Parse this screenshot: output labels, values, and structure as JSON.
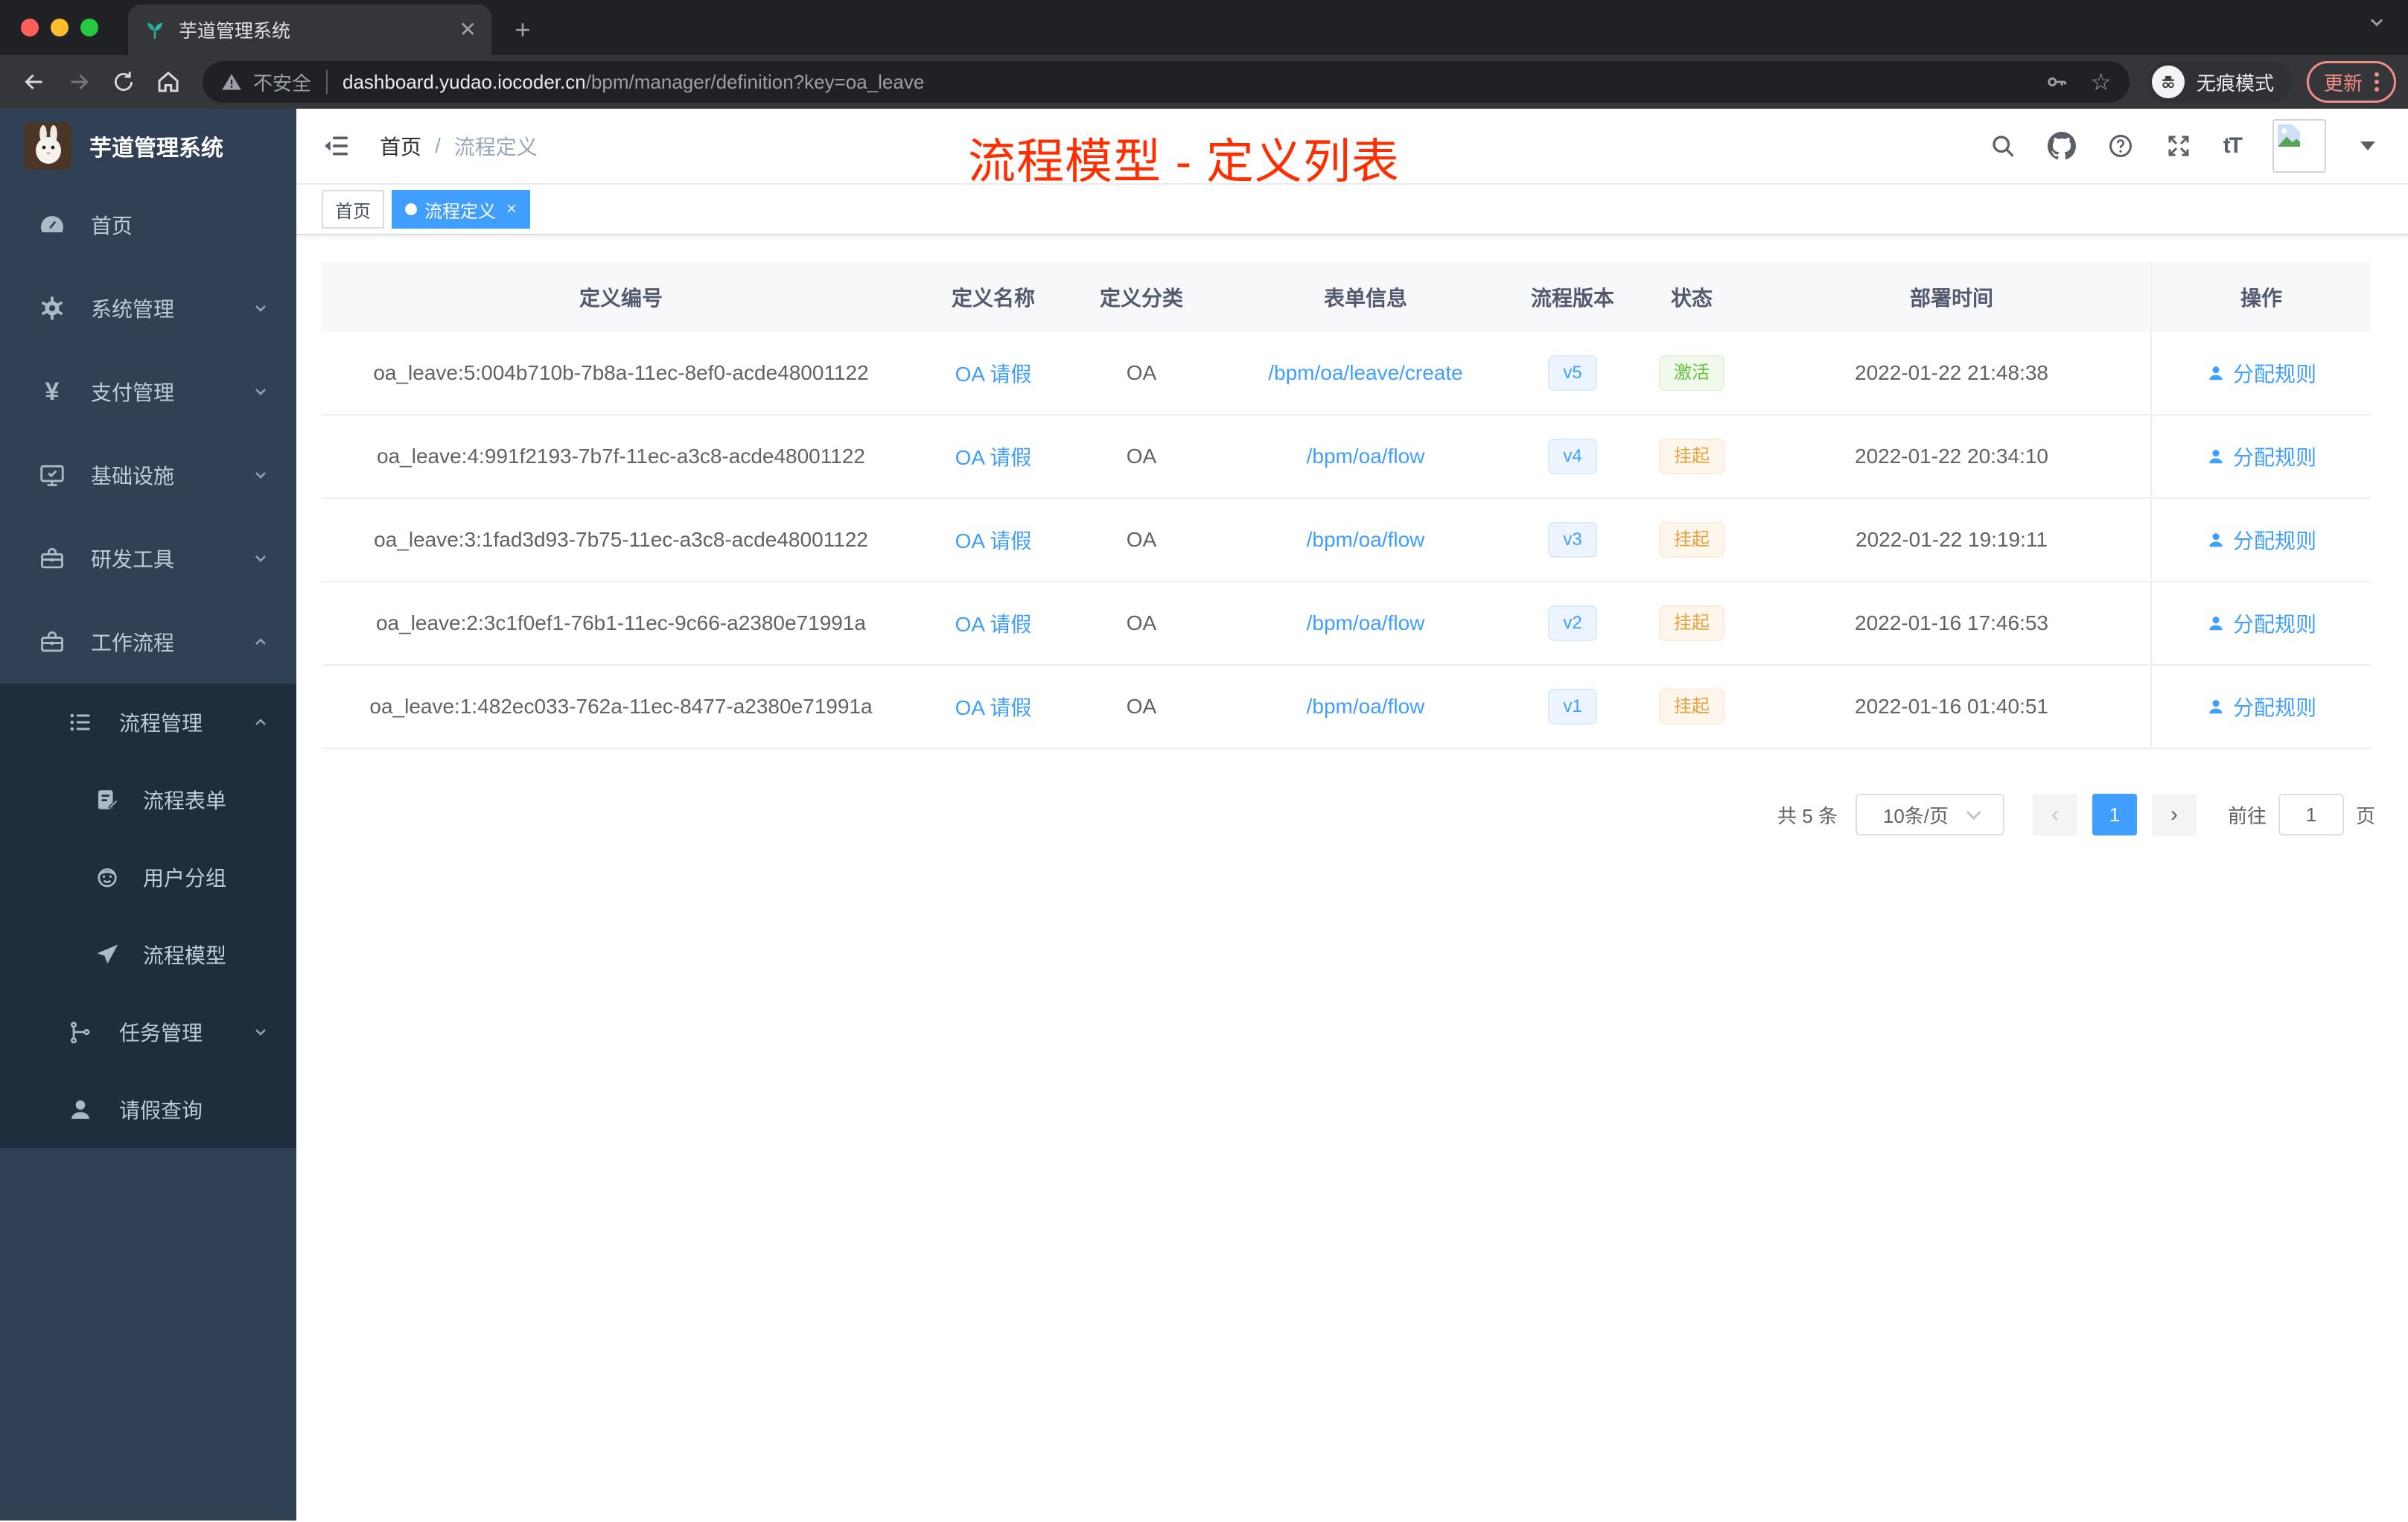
{
  "browser": {
    "tab_title": "芋道管理系统",
    "security_label": "不安全",
    "url_host": "dashboard.yudao.iocoder.cn",
    "url_path": "/bpm/manager/definition?key=oa_leave",
    "incognito_label": "无痕模式",
    "update_label": "更新"
  },
  "sidebar": {
    "logo_title": "芋道管理系统",
    "items": [
      {
        "label": "首页",
        "icon": "dashboard-icon",
        "level": 1
      },
      {
        "label": "系统管理",
        "icon": "gear-icon",
        "level": 1,
        "chevron": "down"
      },
      {
        "label": "支付管理",
        "icon": "yen-icon",
        "level": 1,
        "chevron": "down"
      },
      {
        "label": "基础设施",
        "icon": "monitor-icon",
        "level": 1,
        "chevron": "down"
      },
      {
        "label": "研发工具",
        "icon": "toolbox-icon",
        "level": 1,
        "chevron": "down"
      },
      {
        "label": "工作流程",
        "icon": "toolbox-icon",
        "level": 1,
        "chevron": "up"
      },
      {
        "label": "流程管理",
        "icon": "list-icon",
        "level": 2,
        "chevron": "up"
      },
      {
        "label": "流程表单",
        "icon": "form-icon",
        "level": 3
      },
      {
        "label": "用户分组",
        "icon": "robot-icon",
        "level": 3
      },
      {
        "label": "流程模型",
        "icon": "send-icon",
        "level": 3
      },
      {
        "label": "任务管理",
        "icon": "branch-icon",
        "level": 2,
        "chevron": "down"
      },
      {
        "label": "请假查询",
        "icon": "user-icon",
        "level": 2
      }
    ]
  },
  "header": {
    "breadcrumb_home": "首页",
    "breadcrumb_separator": "/",
    "breadcrumb_current": "流程定义",
    "annotation": "流程模型 - 定义列表",
    "annotation_color": "#ff2d00"
  },
  "tags": {
    "home": "首页",
    "active": "流程定义"
  },
  "table": {
    "columns": [
      "定义编号",
      "定义名称",
      "定义分类",
      "表单信息",
      "流程版本",
      "状态",
      "部署时间",
      "操作"
    ],
    "rows": [
      {
        "id": "oa_leave:5:004b710b-7b8a-11ec-8ef0-acde48001122",
        "name": "OA 请假",
        "category": "OA",
        "form": "/bpm/oa/leave/create",
        "version": "v5",
        "status_label": "激活",
        "status_type": "success",
        "deployed_at": "2022-01-22 21:48:38",
        "action": "分配规则"
      },
      {
        "id": "oa_leave:4:991f2193-7b7f-11ec-a3c8-acde48001122",
        "name": "OA 请假",
        "category": "OA",
        "form": "/bpm/oa/flow",
        "version": "v4",
        "status_label": "挂起",
        "status_type": "warning",
        "deployed_at": "2022-01-22 20:34:10",
        "action": "分配规则"
      },
      {
        "id": "oa_leave:3:1fad3d93-7b75-11ec-a3c8-acde48001122",
        "name": "OA 请假",
        "category": "OA",
        "form": "/bpm/oa/flow",
        "version": "v3",
        "status_label": "挂起",
        "status_type": "warning",
        "deployed_at": "2022-01-22 19:19:11",
        "action": "分配规则"
      },
      {
        "id": "oa_leave:2:3c1f0ef1-76b1-11ec-9c66-a2380e71991a",
        "name": "OA 请假",
        "category": "OA",
        "form": "/bpm/oa/flow",
        "version": "v2",
        "status_label": "挂起",
        "status_type": "warning",
        "deployed_at": "2022-01-16 17:46:53",
        "action": "分配规则"
      },
      {
        "id": "oa_leave:1:482ec033-762a-11ec-8477-a2380e71991a",
        "name": "OA 请假",
        "category": "OA",
        "form": "/bpm/oa/flow",
        "version": "v1",
        "status_label": "挂起",
        "status_type": "warning",
        "deployed_at": "2022-01-16 01:40:51",
        "action": "分配规则"
      }
    ]
  },
  "pagination": {
    "total": "共 5 条",
    "page_size": "10条/页",
    "prev": "‹",
    "current_page": "1",
    "next": "›",
    "goto_label": "前往",
    "goto_value": "1",
    "page_unit": "页"
  },
  "colors": {
    "accent": "#409eff",
    "sidebar_bg": "#304156",
    "sidebar_nested_bg": "#1f2d3d",
    "success": "#67c23a",
    "warning": "#e6a23c",
    "annotation_red": "#ff2d00"
  }
}
